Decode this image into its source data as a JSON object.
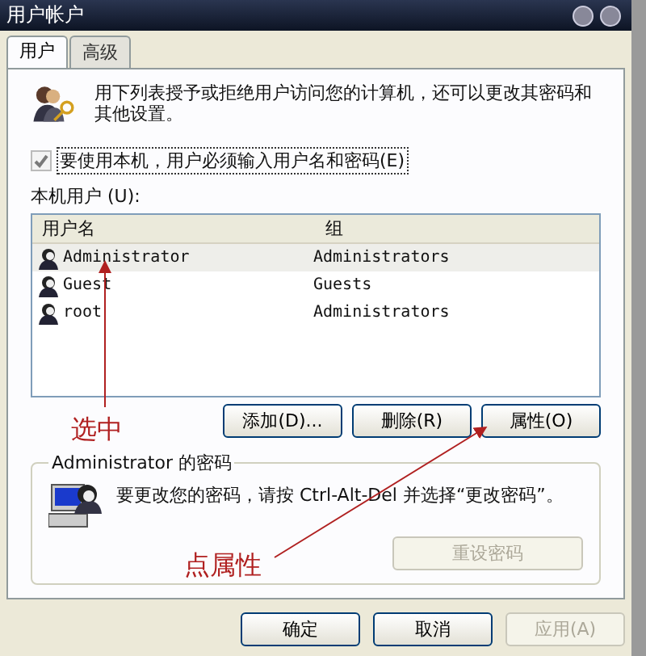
{
  "window": {
    "title": "用户帐户"
  },
  "tabs": [
    {
      "label": "用户",
      "selected": true
    },
    {
      "label": "高级",
      "selected": false
    }
  ],
  "intro": "用下列表授予或拒绝用户访问您的计算机，还可以更改其密码和其他设置。",
  "require_login": {
    "label": "要使用本机，用户必须输入用户名和密码(E)",
    "checked": true
  },
  "users_label": "本机用户 (U):",
  "table": {
    "columns": [
      "用户名",
      "组"
    ],
    "rows": [
      {
        "cells": [
          "Administrator",
          "Administrators"
        ],
        "selected": true
      },
      {
        "cells": [
          "Guest",
          "Guests"
        ],
        "selected": false
      },
      {
        "cells": [
          "root",
          "Administrators"
        ],
        "selected": false
      }
    ]
  },
  "user_buttons": [
    {
      "label": "添加(D)...",
      "disabled": false
    },
    {
      "label": "删除(R)",
      "disabled": false
    },
    {
      "label": "属性(O)",
      "disabled": false
    }
  ],
  "password_group": {
    "title": "Administrator 的密码",
    "text": "要更改您的密码，请按 Ctrl-Alt-Del 并选择“更改密码”。",
    "button": {
      "label": "重设密码",
      "disabled": true
    }
  },
  "buttons": [
    {
      "label": "确定",
      "disabled": false
    },
    {
      "label": "取消",
      "disabled": false
    },
    {
      "label": "应用(A)",
      "disabled": true
    }
  ],
  "annotations": [
    {
      "text": "选中"
    },
    {
      "text": "点属性"
    }
  ]
}
